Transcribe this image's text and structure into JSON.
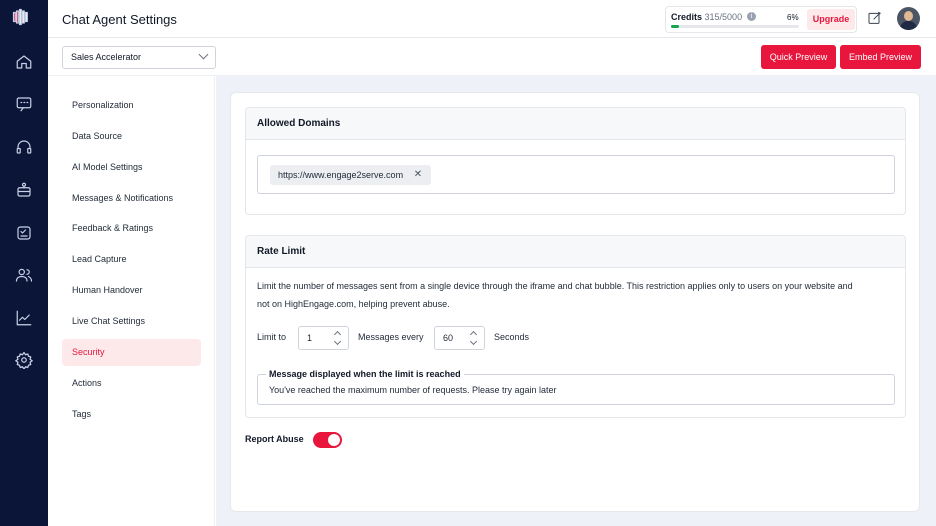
{
  "header": {
    "title": "Chat Agent Settings",
    "credits_label": "Credits",
    "credits_value": "315/5000",
    "credits_percent": "6%",
    "credits_fraction": 0.06,
    "upgrade_label": "Upgrade"
  },
  "subbar": {
    "agent_select": "Sales Accelerator",
    "quick_preview": "Quick Preview",
    "embed_preview": "Embed Preview"
  },
  "menu": {
    "items": [
      "Personalization",
      "Data Source",
      "AI Model Settings",
      "Messages & Notifications",
      "Feedback & Ratings",
      "Lead Capture",
      "Human Handover",
      "Live Chat Settings",
      "Security",
      "Actions",
      "Tags"
    ],
    "active": "Security"
  },
  "allowed_domains": {
    "title": "Allowed Domains",
    "domains": [
      "https://www.engage2serve.com"
    ]
  },
  "rate_limit": {
    "title": "Rate Limit",
    "description_line1": "Limit the number of messages sent from a single device through the iframe and chat bubble. This restriction applies only to users on your website and",
    "description_line2": "not on HighEngage.com, helping prevent abuse.",
    "limit_to_label": "Limit to",
    "limit_value": "1",
    "messages_every_label": "Messages every",
    "seconds_value": "60",
    "seconds_label": "Seconds",
    "message_legend": "Message displayed when the limit is reached",
    "message_value": "You've reached the maximum number of requests. Please try again later"
  },
  "report_abuse": {
    "label": "Report Abuse",
    "enabled": true
  },
  "colors": {
    "accent": "#e8163c",
    "rail": "#0b1538"
  }
}
